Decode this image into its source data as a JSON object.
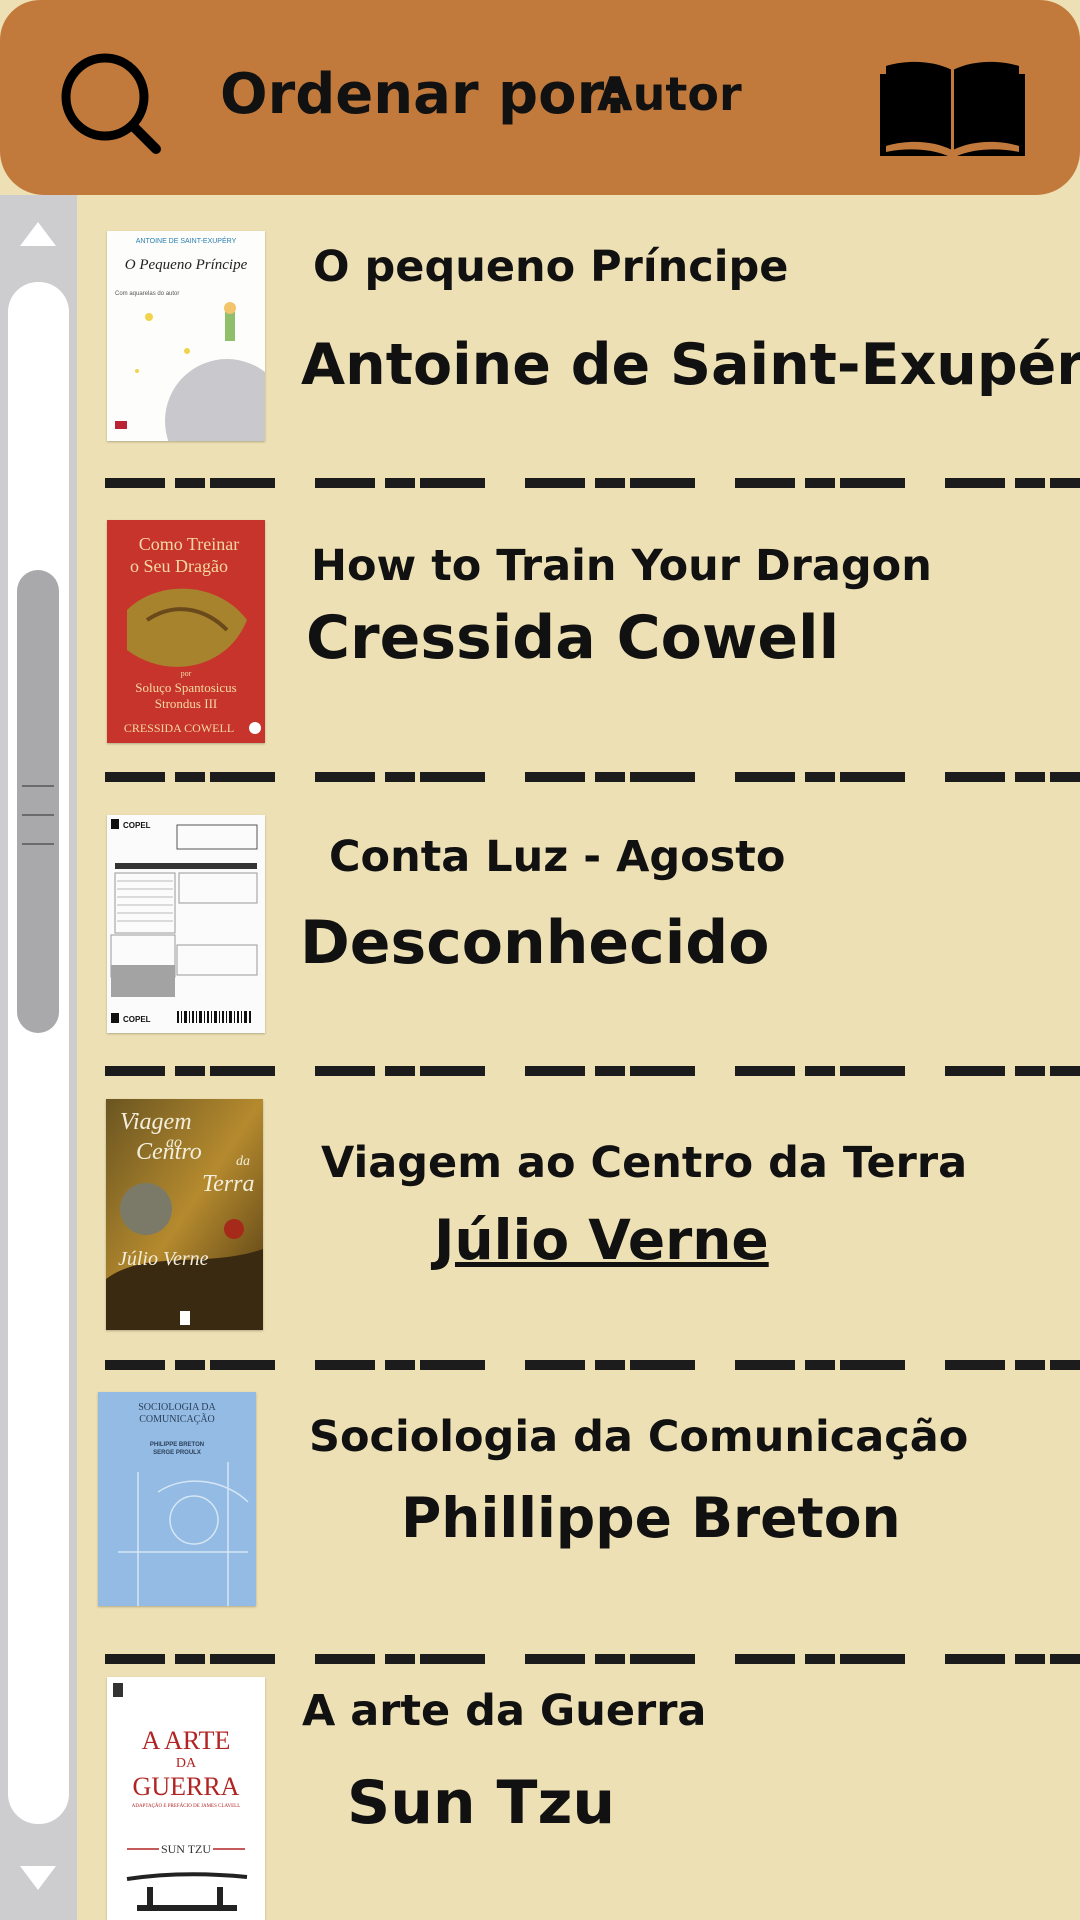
{
  "header": {
    "sort_label": "Ordenar por:",
    "sort_value": "Autor",
    "search_icon": "search-icon",
    "book_icon": "open-book-icon",
    "background": "#c27a3c"
  },
  "scrollbar": {
    "up_icon": "arrow-up-icon",
    "down_icon": "arrow-down-icon"
  },
  "books": [
    {
      "title": "O pequeno Príncipe",
      "author": "Antoine de Saint-Exupéry",
      "cover_text": [
        "ANTOINE DE SAINT-EXUPÉRY",
        "O Pequeno Príncipe",
        "Com aquarelas do autor"
      ]
    },
    {
      "title": "How to Train Your Dragon",
      "author": "Cressida Cowell",
      "cover_text": [
        "Como Treinar",
        "o Seu Dragão",
        "por",
        "Soluço Spantosicus",
        "Strondus III",
        "CRESSIDA COWELL"
      ]
    },
    {
      "title": "Conta Luz - Agosto",
      "author": "Desconhecido",
      "cover_text": [
        "COPEL",
        "COPEL"
      ]
    },
    {
      "title": "Viagem ao Centro da Terra",
      "author": "Júlio Verne",
      "cover_text": [
        "Viagem",
        "ao",
        "Centro",
        "da",
        "Terra",
        "Júlio Verne"
      ]
    },
    {
      "title": "Sociologia da Comunicação",
      "author": "Phillippe Breton",
      "cover_text": [
        "SOCIOLOGIA DA",
        "COMUNICAÇÃO",
        "PHILIPPE BRETON",
        "SERGE PROULX"
      ]
    },
    {
      "title": "A arte da Guerra",
      "author": "Sun Tzu",
      "cover_text": [
        "A ARTE",
        "DA",
        "GUERRA",
        "ADAPTAÇÃO E PREFÁCIO DE JAMES CLAVELL",
        "SUN TZU"
      ]
    }
  ]
}
